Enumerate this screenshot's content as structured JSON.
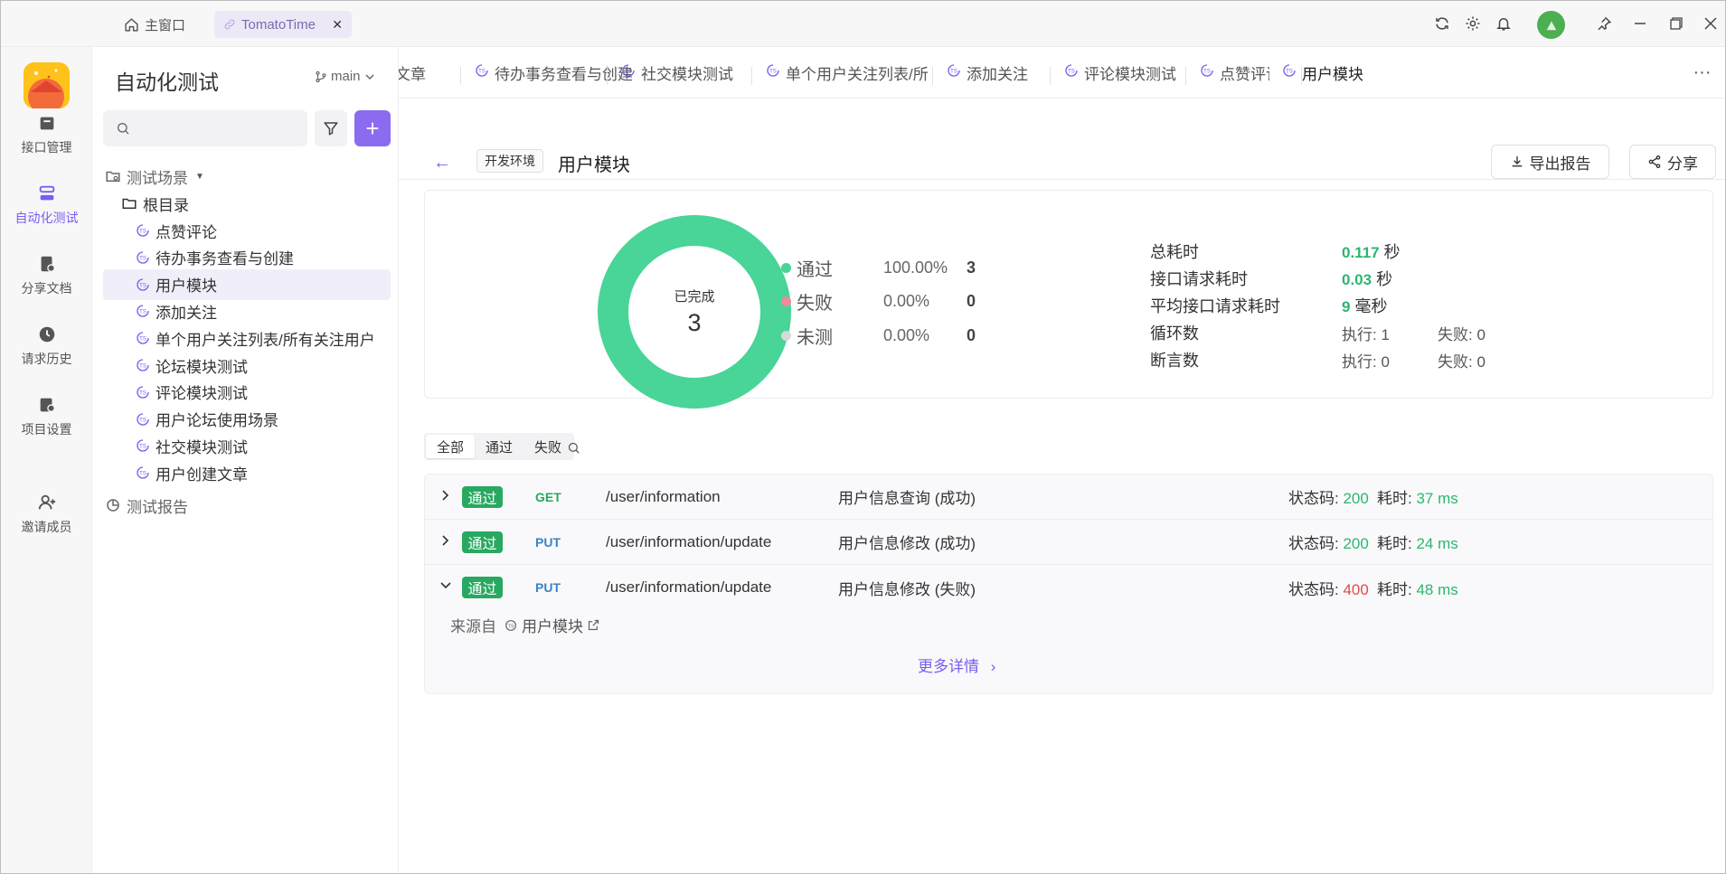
{
  "titlebar": {
    "home_label": "主窗口",
    "tab_label": "TomatoTime",
    "close_glyph": "✕"
  },
  "leftnav": {
    "items": [
      {
        "label": "接口管理",
        "icon": "api-icon"
      },
      {
        "label": "自动化测试",
        "icon": "automation-icon",
        "active": true
      },
      {
        "label": "分享文档",
        "icon": "share-doc-icon"
      },
      {
        "label": "请求历史",
        "icon": "history-icon"
      },
      {
        "label": "项目设置",
        "icon": "settings-icon"
      },
      {
        "label": "邀请成员",
        "icon": "invite-icon"
      }
    ]
  },
  "sidebar": {
    "title": "自动化测试",
    "branch": "main",
    "search_placeholder": "",
    "add_glyph": "+",
    "tree": {
      "scenes_label": "测试场景",
      "root_label": "根目录",
      "items": [
        "点赞评论",
        "待办事务查看与创建",
        "用户模块",
        "添加关注",
        "单个用户关注列表/所有关注用户",
        "论坛模块测试",
        "评论模块测试",
        "用户论坛使用场景",
        "社交模块测试",
        "用户创建文章"
      ],
      "selected": "用户模块",
      "reports_label": "测试报告"
    }
  },
  "tabs": {
    "items": [
      "文章",
      "待办事务查看与创建",
      "社交模块测试",
      "单个用户关注列表/所",
      "添加关注",
      "评论模块测试",
      "点赞评论",
      "用户模块"
    ],
    "active": "用户模块",
    "more_glyph": "···"
  },
  "header": {
    "back_glyph": "←",
    "env": "开发环境",
    "title": "用户模块",
    "export_label": "导出报告",
    "share_label": "分享"
  },
  "summary": {
    "done_label": "已完成",
    "done_count": "3",
    "legend": [
      {
        "name": "通过",
        "pct": "100.00%",
        "count": "3",
        "color": "#48d597"
      },
      {
        "name": "失败",
        "pct": "0.00%",
        "count": "0",
        "color": "#f08a9b"
      },
      {
        "name": "未测",
        "pct": "0.00%",
        "count": "0",
        "color": "#d9d9d9"
      }
    ],
    "stats": {
      "total_time_label": "总耗时",
      "total_time_value": "0.117",
      "total_time_unit": "秒",
      "req_time_label": "接口请求耗时",
      "req_time_value": "0.03",
      "req_time_unit": "秒",
      "avg_time_label": "平均接口请求耗时",
      "avg_time_value": "9",
      "avg_time_unit": "毫秒",
      "loops_label": "循环数",
      "loops_exec": "执行: 1",
      "loops_fail": "失败: 0",
      "asserts_label": "断言数",
      "asserts_exec": "执行: 0",
      "asserts_fail": "失败: 0"
    }
  },
  "filter": {
    "all": "全部",
    "pass": "通过",
    "fail": "失败"
  },
  "results": {
    "rows": [
      {
        "status": "通过",
        "method": "GET",
        "path": "/user/information",
        "desc": "用户信息查询 (成功)",
        "code_label": "状态码:",
        "code": "200",
        "dur_label": "耗时:",
        "dur": "37 ms"
      },
      {
        "status": "通过",
        "method": "PUT",
        "path": "/user/information/update",
        "desc": "用户信息修改 (成功)",
        "code_label": "状态码:",
        "code": "200",
        "dur_label": "耗时:",
        "dur": "24 ms"
      },
      {
        "status": "通过",
        "method": "PUT",
        "path": "/user/information/update",
        "desc": "用户信息修改 (失败)",
        "code_label": "状态码:",
        "code": "400",
        "dur_label": "耗时:",
        "dur": "48 ms"
      }
    ],
    "source_label": "来源自",
    "source_link": "用户模块",
    "more_label": "更多详情",
    "more_glyph": "›"
  }
}
